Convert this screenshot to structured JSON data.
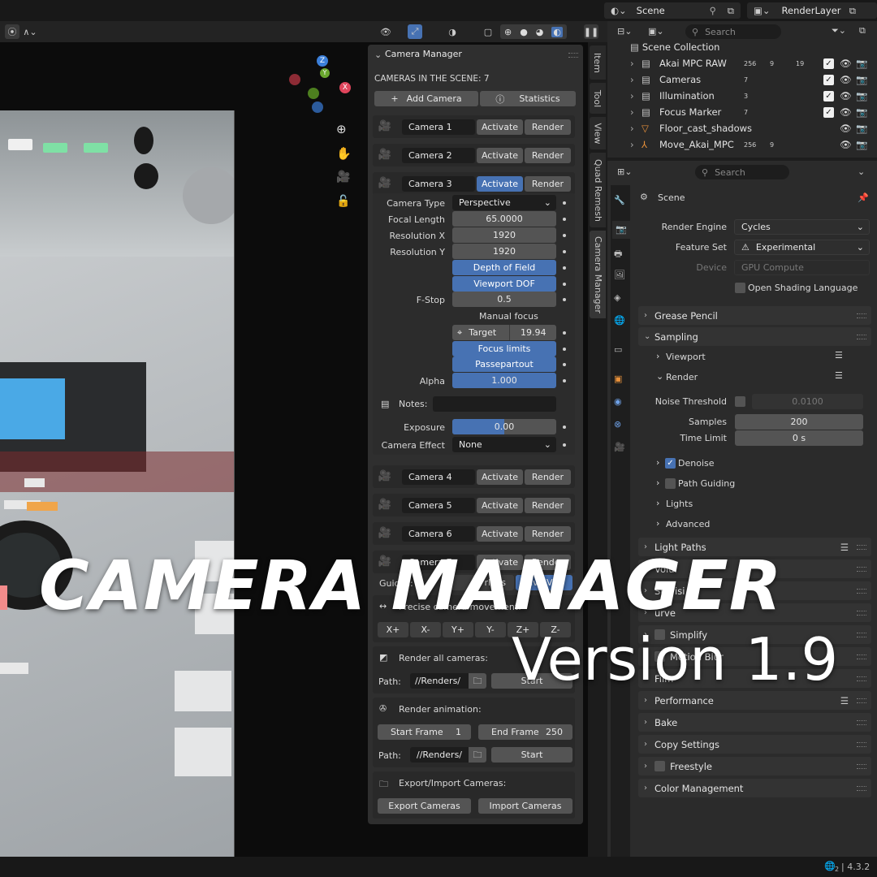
{
  "topbar": {
    "scene": "Scene",
    "view_layer": "RenderLayer"
  },
  "tabs": [
    "Item",
    "Tool",
    "View",
    "Quad Remesh",
    "Camera Manager"
  ],
  "cm": {
    "title": "Camera Manager",
    "count_label": "CAMERAS IN THE SCENE: 7",
    "add_camera": "Add Camera",
    "statistics": "Statistics",
    "activate": "Activate",
    "render": "Render",
    "cameras": [
      "Camera 1",
      "Camera 2",
      "Camera 3",
      "Camera 4",
      "Camera 5",
      "Camera 6",
      "Camera 7"
    ],
    "active_camera_index": 2,
    "props": {
      "camera_type_label": "Camera Type",
      "camera_type": "Perspective",
      "focal_label": "Focal Length",
      "focal": "65.0000",
      "resx_label": "Resolution X",
      "resx": "1920",
      "resy_label": "Resolution Y",
      "resy": "1920",
      "dof": "Depth of Field",
      "viewport_dof": "Viewport DOF",
      "fstop_label": "F-Stop",
      "fstop": "0.5",
      "manual_focus": "Manual focus",
      "target_label": "Target",
      "target": "19.94",
      "focus_limits": "Focus limits",
      "passepartout": "Passepartout",
      "alpha_label": "Alpha",
      "alpha": "1.000",
      "notes_label": "Notes:",
      "exposure_label": "Exposure",
      "exposure": "0.00",
      "effect_label": "Camera Effect",
      "effect": "None"
    },
    "guides_label": "Guides:",
    "guides_overlays": "rlays",
    "guides_live": "Live V",
    "precise_label": "Precise camera movement:",
    "moves": [
      "X+",
      "X-",
      "Y+",
      "Y-",
      "Z+",
      "Z-"
    ],
    "render_all_label": "Render all cameras:",
    "path_label": "Path:",
    "path_value": "//Renders/",
    "start": "Start",
    "render_anim_label": "Render animation:",
    "start_frame_label": "Start Frame",
    "start_frame": "1",
    "end_frame_label": "End Frame",
    "end_frame": "250",
    "export_import_label": "Export/Import Cameras:",
    "export": "Export Cameras",
    "import": "Import Cameras"
  },
  "outliner": {
    "search_placeholder": "Search",
    "root": "Scene Collection",
    "items": [
      {
        "name": "Akai MPC RAW",
        "badge1": "256",
        "badge2": "9",
        "badge3": "19"
      },
      {
        "name": "Cameras",
        "badge1": "7",
        "badge2": "",
        "badge3": ""
      },
      {
        "name": "Illumination",
        "badge1": "3",
        "badge2": "",
        "badge3": ""
      },
      {
        "name": "Focus Marker",
        "badge1": "7",
        "badge2": "",
        "badge3": ""
      },
      {
        "name": "Floor_cast_shadows",
        "badge1": "",
        "badge2": "",
        "badge3": ""
      },
      {
        "name": "Move_Akai_MPC",
        "badge1": "256",
        "badge2": "9",
        "badge3": ""
      }
    ]
  },
  "props": {
    "search_placeholder": "Search",
    "context": "Scene",
    "render_engine_label": "Render Engine",
    "render_engine": "Cycles",
    "feature_set_label": "Feature Set",
    "feature_set": "Experimental",
    "device_label": "Device",
    "device": "GPU Compute",
    "osl": "Open Shading Language",
    "grease_pencil": "Grease Pencil",
    "sampling": "Sampling",
    "viewport": "Viewport",
    "render": "Render",
    "noise_threshold_label": "Noise Threshold",
    "noise_threshold": "0.0100",
    "samples_label": "Samples",
    "samples": "200",
    "time_limit_label": "Time Limit",
    "time_limit": "0 s",
    "denoise": "Denoise",
    "path_guiding": "Path Guiding",
    "lights": "Lights",
    "advanced": "Advanced",
    "light_paths": "Light Paths",
    "volumes": "Volu",
    "subdivision": "Su  visi",
    "curves": "urve",
    "simplify": "Simplify",
    "motion_blur": "Motion Blur",
    "film": "Film",
    "performance": "Performance",
    "bake": "Bake",
    "copy_settings": "Copy Settings",
    "freestyle": "Freestyle",
    "color_management": "Color Management"
  },
  "overlay": {
    "title": "CAMERA MANAGER",
    "version": "Version 1.9"
  },
  "status": {
    "version": "4.3.2",
    "badge": "2"
  }
}
